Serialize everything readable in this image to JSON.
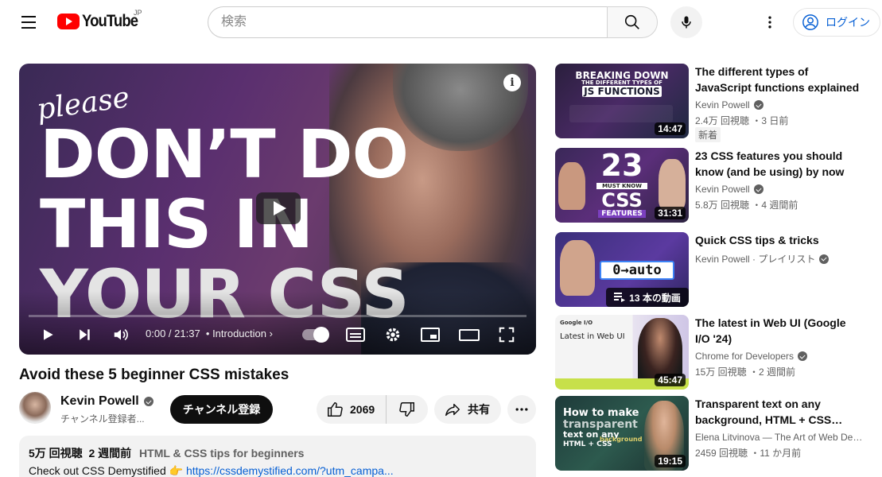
{
  "header": {
    "logo_text": "YouTube",
    "logo_region": "JP",
    "search_placeholder": "検索",
    "login_label": "ログイン"
  },
  "player": {
    "thumb_line_please": "please",
    "thumb_line_1": "DON’T DO",
    "thumb_line_2": "THIS IN",
    "thumb_line_3": "YOUR CSS",
    "time": "0:00 / 21:37",
    "chapter": "• Introduction",
    "progress": 0
  },
  "video": {
    "title": "Avoid these 5 beginner CSS mistakes",
    "channel_name": "Kevin Powell",
    "subscribers": "チャンネル登録者...",
    "subscribe_label": "チャンネル登録",
    "likes": "2069",
    "share_label": "共有",
    "views": "5万 回視聴",
    "posted": "2 週間前",
    "playlist_tag": "HTML & CSS tips for beginners",
    "desc_prefix": "Check out CSS Demystified 👉",
    "desc_link": "https://cssdemystified.com/?utm_campa..."
  },
  "recommendations": [
    {
      "title": "The different types of JavaScript functions explained",
      "channel": "Kevin Powell",
      "verified": true,
      "views": "2.4万 回視聴 ・3 日前",
      "badge": "新着",
      "duration": "14:47",
      "thumb_text_1": "BREAKING DOWN",
      "thumb_text_2": "THE DIFFERENT TYPES OF",
      "thumb_text_3": "JS FUNCTIONS"
    },
    {
      "title": "23 CSS features you should know (and be using) by now",
      "channel": "Kevin Powell",
      "verified": true,
      "views": "5.8万 回視聴 ・4 週間前",
      "duration": "31:31",
      "thumb_text_1": "23",
      "thumb_text_2": "MUST KNOW",
      "thumb_text_3": "CSS",
      "thumb_text_4": "FEATURES"
    },
    {
      "title": "Quick CSS tips & tricks",
      "channel": "Kevin Powell · プレイリスト",
      "verified": true,
      "duration": "13 本の動画",
      "thumb_text_1": "0→auto"
    },
    {
      "title": "The latest in Web UI (Google I/O '24)",
      "channel": "Chrome for Developers",
      "verified": true,
      "views": "15万 回視聴 ・2 週間前",
      "duration": "45:47",
      "thumb_text_1": "Google I/O",
      "thumb_text_2": "Latest in Web UI"
    },
    {
      "title": "Transparent text on any background, HTML + CSS…",
      "channel": "Elena Litvinova — The Art of Web De…",
      "views": "2459 回視聴 ・11 か月前",
      "duration": "19:15",
      "thumb_text_1": "How to make",
      "thumb_text_2": "transparent",
      "thumb_text_3": "text on any",
      "thumb_text_4": "background",
      "thumb_text_5": "HTML + CSS"
    }
  ],
  "colors": {
    "brand_red": "#ff0000",
    "link_blue": "#065fd4",
    "text_secondary": "#606060"
  },
  "icons": [
    "menu-icon",
    "youtube-logo-icon",
    "search-icon",
    "mic-icon",
    "more-vert-icon",
    "account-icon",
    "info-icon",
    "play-icon",
    "next-icon",
    "volume-icon",
    "captions-icon",
    "settings-icon",
    "miniplayer-icon",
    "theater-icon",
    "fullscreen-icon",
    "thumbs-up-icon",
    "thumbs-down-icon",
    "share-icon",
    "more-horiz-icon",
    "verified-icon",
    "playlist-icon"
  ]
}
